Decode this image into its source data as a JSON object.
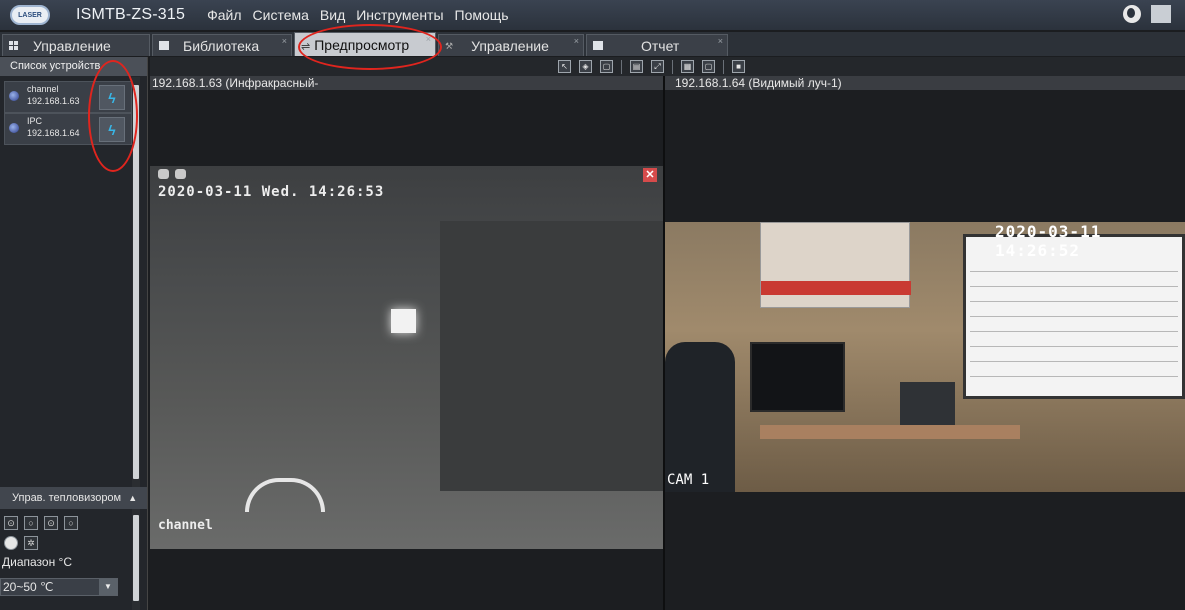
{
  "app": {
    "title": "ISMTB-ZS-315",
    "logo_text": "LASER",
    "menu": [
      "Файл",
      "Система",
      "Вид",
      "Инструменты",
      "Помощь"
    ]
  },
  "tabs": [
    {
      "label": "Управление",
      "active": false
    },
    {
      "label": "Библиотека",
      "active": false
    },
    {
      "label": "Предпросмотр",
      "active": true
    },
    {
      "label": "Управление",
      "active": false
    },
    {
      "label": "Отчет",
      "active": false
    }
  ],
  "left_panel": {
    "device_list_title": "Список устройств",
    "devices": [
      {
        "name": "channel",
        "ip": "192.168.1.63"
      },
      {
        "name": "IPC",
        "ip": "192.168.1.64"
      }
    ],
    "thermal_section_title": "Управ. тепловизором",
    "range_label": "Диапазон °C",
    "range_value": "20~50 ℃"
  },
  "panes": {
    "left_title": "192.168.1.63 (Инфракрасный-",
    "right_title": "192.168.1.64 (Видимый луч-1)"
  },
  "ir_feed": {
    "timestamp": "2020-03-11 Wed. 14:26:53",
    "channel_label": "channel"
  },
  "visible_feed": {
    "timestamp": "2020-03-11 14:26:52",
    "cam_label": "CAM 1"
  },
  "colors": {
    "annotation": "#e0251e",
    "connect_icon": "#38b7e8"
  }
}
